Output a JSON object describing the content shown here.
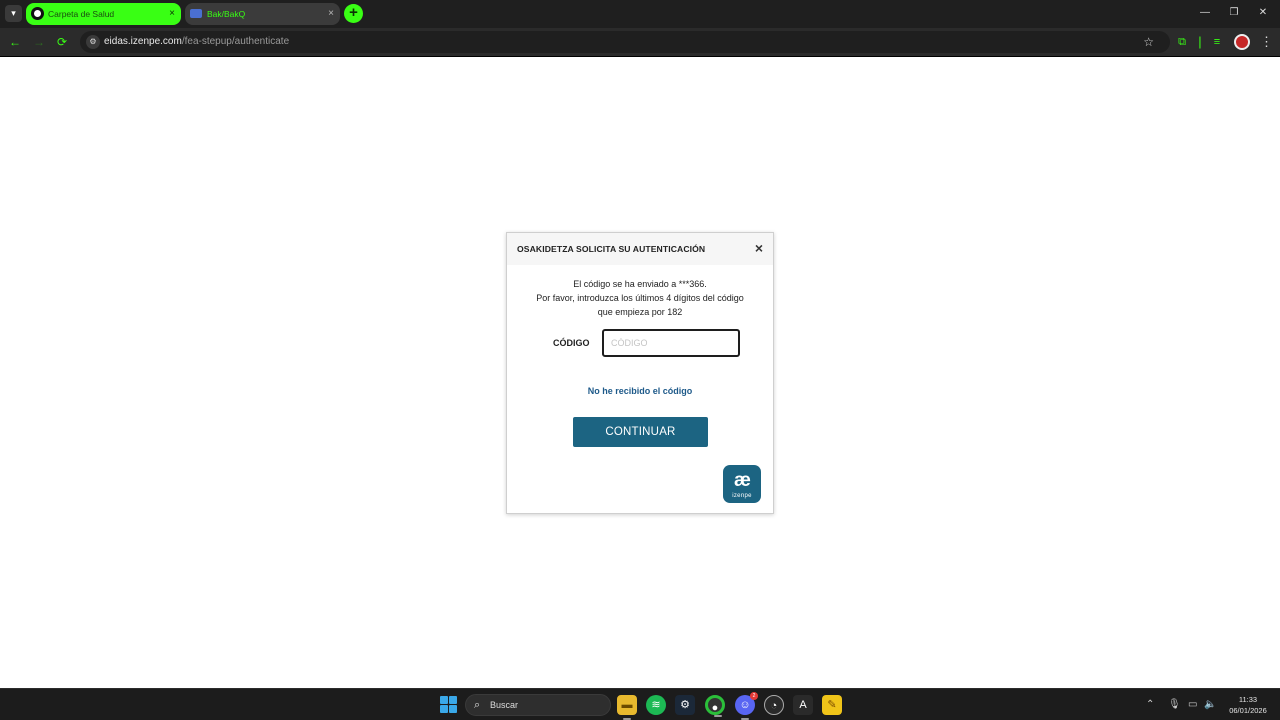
{
  "browser": {
    "tabs": [
      {
        "title": "Carpeta de Salud",
        "active": true
      },
      {
        "title": "Bak/BakQ",
        "active": false
      }
    ],
    "tab_close_icon": "×",
    "new_tab_icon": "+",
    "address": {
      "host": "eidas.izenpe.com",
      "path": "/fea-stepup/authenticate"
    },
    "accent_color": "#39ff14"
  },
  "dialog": {
    "title": "OSAKIDETZA  SOLICITA SU AUTENTICACIÓN",
    "close_icon": "×",
    "message_line_1": "El código se ha enviado a ***366.",
    "message_line_2": "Por favor, introduzca los últimos 4 dígitos del código",
    "message_line_3": "que empieza por 182",
    "code_label": "CÓDIGO",
    "code_placeholder": "CÓDIGO",
    "code_value": "",
    "resend_link": "No he recibido el código",
    "continue_button": "CONTINUAR",
    "logo_glyph": "æ",
    "logo_text": "izenpe",
    "brand_color": "#1c6482"
  },
  "taskbar": {
    "search_placeholder": "Buscar",
    "clock_time": "11:33",
    "clock_date": "06/01/2026",
    "discord_badge": "2"
  }
}
